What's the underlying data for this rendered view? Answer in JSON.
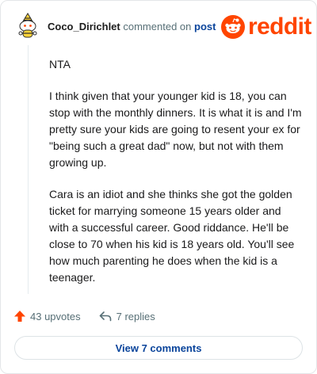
{
  "comment": {
    "username": "Coco_Dirichlet",
    "action_text": "commented on",
    "post_link": "post",
    "paragraphs": [
      "NTA",
      "I think given that your younger kid is 18, you can stop with the monthly dinners. It is what it is and I'm pretty sure your kids are going to resent your ex for \"being such a great dad\" now, but not with them growing up.",
      "Cara is an idiot and she thinks she got the golden ticket for marrying someone 15 years older and with a successful career. Good riddance. He'll be close to 70 when his kid is 18 years old. You'll see how much parenting he does when the kid is a teenager."
    ]
  },
  "brand": {
    "wordmark": "reddit",
    "color": "#ff4500"
  },
  "actions": {
    "upvotes_label": "43 upvotes",
    "replies_label": "7 replies",
    "upvote_icon": "arrow-up-icon",
    "reply_icon": "reply-arrow-icon",
    "upvote_color": "#ff4500"
  },
  "view_button": {
    "label": "View 7 comments"
  }
}
